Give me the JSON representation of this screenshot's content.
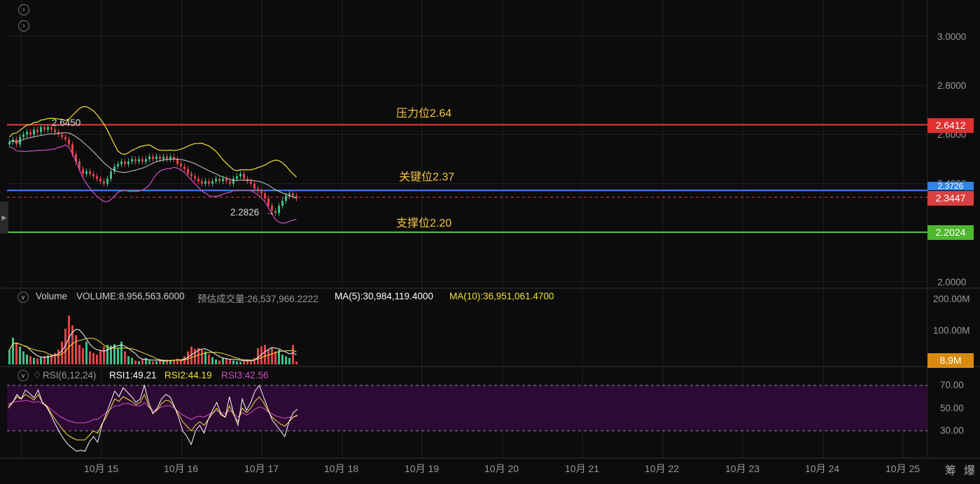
{
  "chart_data": {
    "type": "candlestick",
    "price_axis": {
      "ticks": [
        "3.0000",
        "2.8000",
        "2.6000",
        "2.4000",
        "2.0000"
      ],
      "ylim": [
        1.96,
        3.1
      ]
    },
    "x_labels": [
      "10月 15",
      "10月 16",
      "10月 17",
      "10月 18",
      "10月 19",
      "10月 20",
      "10月 21",
      "10月 22",
      "10月 23",
      "10月 24",
      "10月 25"
    ],
    "levels": [
      {
        "name": "压力位2.64",
        "value": 2.64,
        "tag": "2.6412",
        "color": "#e83a3a"
      },
      {
        "name": "关键位2.37",
        "value": 2.3726,
        "tag": "2.3726",
        "color": "#3a8ef0"
      },
      {
        "name": "支撑位2.20",
        "value": 2.2024,
        "tag": "2.2024",
        "color": "#56c53a"
      }
    ],
    "last_price": {
      "value": 2.3447,
      "tag": "2.3447",
      "color": "#e04545"
    },
    "annotations": [
      {
        "text": "2.6450"
      },
      {
        "text": "2.2826"
      }
    ],
    "candles_close": [
      2.57,
      2.58,
      2.56,
      2.59,
      2.6,
      2.61,
      2.6,
      2.62,
      2.61,
      2.63,
      2.62,
      2.63,
      2.62,
      2.61,
      2.6,
      2.59,
      2.58,
      2.56,
      2.52,
      2.49,
      2.46,
      2.44,
      2.45,
      2.44,
      2.43,
      2.42,
      2.41,
      2.4,
      2.42,
      2.45,
      2.47,
      2.48,
      2.49,
      2.48,
      2.49,
      2.5,
      2.49,
      2.5,
      2.49,
      2.5,
      2.51,
      2.5,
      2.51,
      2.5,
      2.51,
      2.5,
      2.51,
      2.5,
      2.48,
      2.47,
      2.46,
      2.44,
      2.43,
      2.42,
      2.41,
      2.4,
      2.41,
      2.4,
      2.41,
      2.42,
      2.41,
      2.42,
      2.41,
      2.4,
      2.42,
      2.43,
      2.44,
      2.42,
      2.41,
      2.4,
      2.38,
      2.37,
      2.36,
      2.34,
      2.31,
      2.29,
      2.28,
      2.31,
      2.33,
      2.35,
      2.36,
      2.35,
      2.34
    ],
    "volume": {
      "label": "Volume",
      "summary": "VOLUME:8,956,563.6000",
      "est": "预估成交量:26,537,966.2222",
      "ma5": "MA(5):30,984,119.4000",
      "ma10": "MA(10):36,951,061.4700",
      "ticks": [
        "200.00M",
        "100.00M"
      ],
      "tag": "8.9M",
      "values_m": [
        45,
        82,
        68,
        55,
        40,
        30,
        25,
        20,
        18,
        22,
        25,
        28,
        30,
        35,
        45,
        70,
        110,
        150,
        120,
        90,
        60,
        50,
        70,
        40,
        35,
        30,
        42,
        55,
        60,
        58,
        62,
        50,
        70,
        40,
        25,
        20,
        12,
        10,
        15,
        20,
        12,
        9,
        10,
        12,
        10,
        14,
        12,
        15,
        18,
        12,
        25,
        40,
        55,
        48,
        50,
        45,
        40,
        30,
        22,
        15,
        12,
        20,
        18,
        15,
        12,
        10,
        8,
        12,
        15,
        10,
        20,
        50,
        55,
        60,
        45,
        50,
        40,
        45,
        30,
        25,
        20,
        60,
        9
      ]
    },
    "rsi": {
      "label": "RSI(6,12,24)",
      "rsi1": "RSI1:49.21",
      "rsi2": "RSI2:44.19",
      "rsi3": "RSI3:42.56",
      "ticks": [
        "70.00",
        "50.00",
        "30.00"
      ],
      "rsi1_values": [
        50,
        55,
        62,
        58,
        66,
        63,
        59,
        66,
        55,
        51,
        44,
        36,
        29,
        23,
        18,
        15,
        12,
        13,
        12,
        20,
        25,
        20,
        35,
        45,
        55,
        65,
        60,
        68,
        64,
        60,
        55,
        58,
        70,
        55,
        45,
        50,
        58,
        62,
        60,
        52,
        42,
        30,
        25,
        18,
        30,
        35,
        28,
        40,
        48,
        55,
        45,
        42,
        60,
        45,
        35,
        58,
        48,
        55,
        65,
        70,
        60,
        50,
        40,
        35,
        30,
        25,
        38,
        46,
        49
      ],
      "rsi2_values": [
        52,
        55,
        60,
        58,
        62,
        60,
        57,
        62,
        55,
        52,
        46,
        40,
        35,
        30,
        26,
        24,
        22,
        22,
        22,
        26,
        30,
        28,
        36,
        42,
        50,
        58,
        56,
        60,
        58,
        56,
        53,
        55,
        62,
        52,
        46,
        48,
        54,
        57,
        56,
        51,
        45,
        38,
        34,
        30,
        35,
        38,
        35,
        40,
        45,
        50,
        44,
        42,
        52,
        44,
        38,
        50,
        46,
        50,
        56,
        60,
        55,
        48,
        42,
        39,
        36,
        34,
        38,
        42,
        44
      ],
      "rsi3_values": [
        54,
        55,
        56,
        56,
        57,
        56,
        55,
        56,
        54,
        52,
        49,
        46,
        43,
        41,
        39,
        38,
        37,
        37,
        37,
        38,
        40,
        40,
        43,
        46,
        49,
        52,
        52,
        54,
        54,
        53,
        52,
        52,
        55,
        51,
        48,
        49,
        51,
        52,
        52,
        50,
        47,
        44,
        42,
        40,
        42,
        43,
        42,
        44,
        46,
        48,
        46,
        45,
        48,
        45,
        42,
        46,
        44,
        46,
        49,
        51,
        50,
        47,
        45,
        43,
        42,
        41,
        42,
        42,
        43
      ]
    }
  }
}
